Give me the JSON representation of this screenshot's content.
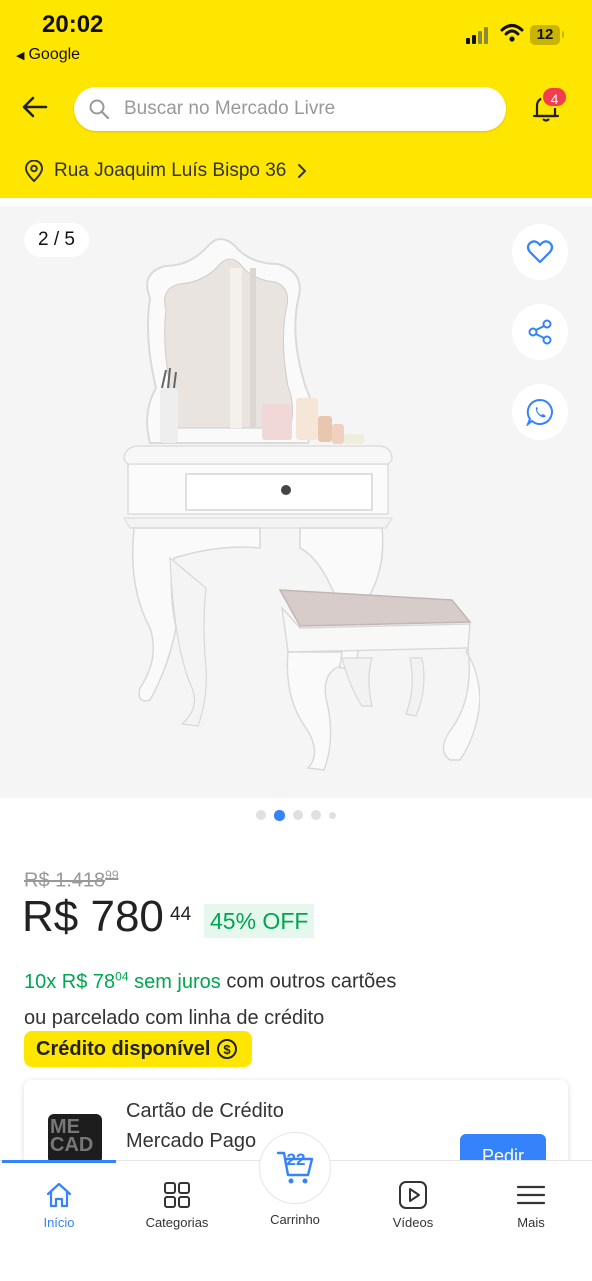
{
  "status_bar": {
    "time": "20:02",
    "back_app": "Google",
    "battery": "12"
  },
  "header": {
    "search_placeholder": "Buscar no Mercado Livre",
    "notifications_count": "4",
    "address": "Rua Joaquim Luís Bispo 36"
  },
  "gallery": {
    "counter_current": "2",
    "counter_sep": "/",
    "counter_total": "5",
    "active_index": 1,
    "dot_count": 5
  },
  "product": {
    "old_price": "R$ 1.418",
    "old_price_cents": "99",
    "price": "R$ 780",
    "price_cents": "44",
    "discount": "45% OFF",
    "installments_prefix": "10x R$ 78",
    "installments_cents": "04",
    "installments_interest": " sem juros",
    "installments_suffix": " com outros cartões",
    "installments_line2": "ou parcelado com linha de crédito",
    "credit_badge": "Crédito disponível"
  },
  "card_offer": {
    "title": "Cartão de Crédito Mercado Pago",
    "button": "Pedir",
    "image_text": "ME CAD"
  },
  "tabbar": {
    "items": [
      {
        "label": "Início",
        "icon": "home-icon",
        "active": true
      },
      {
        "label": "Categorias",
        "icon": "grid-icon",
        "active": false
      },
      {
        "label": "Carrinho",
        "icon": "cart-icon",
        "active": false
      },
      {
        "label": "Vídeos",
        "icon": "play-icon",
        "active": false
      },
      {
        "label": "Mais",
        "icon": "menu-icon",
        "active": false
      }
    ],
    "cart_count": "22"
  },
  "colors": {
    "brand_yellow": "#FFE600",
    "accent_blue": "#3483FA",
    "green": "#00A650",
    "badge_red": "#F23D4F"
  }
}
